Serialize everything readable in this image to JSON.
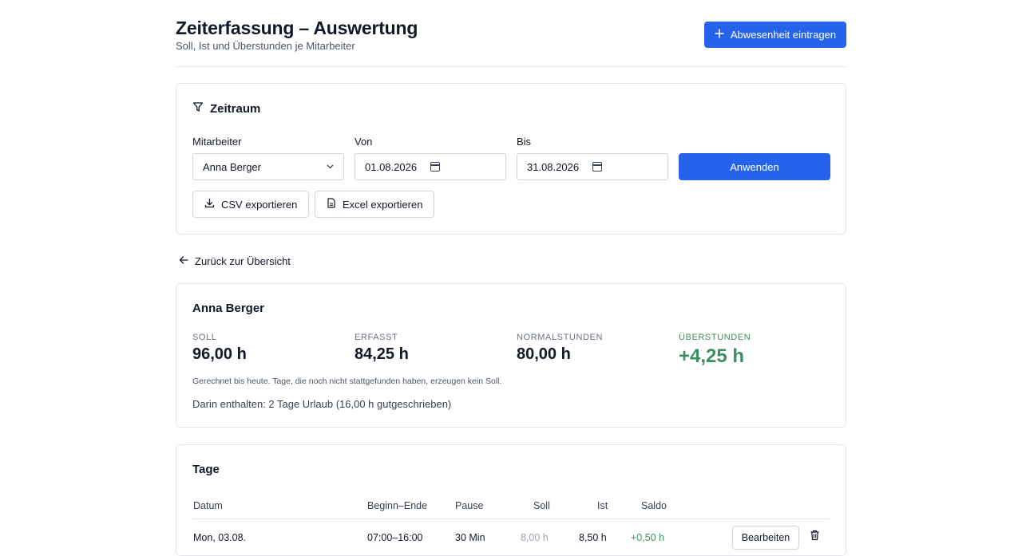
{
  "header": {
    "title": "Zeiterfassung – Auswertung",
    "subtitle": "Soll, Ist und Überstunden je Mitarbeiter",
    "absence_button": "Abwesenheit eintragen"
  },
  "filter": {
    "title": "Zeitraum",
    "employee_label": "Mitarbeiter",
    "employee_value": "Anna Berger",
    "from_label": "Von",
    "from_value": "01.08.2026",
    "to_label": "Bis",
    "to_value": "31.08.2026",
    "apply_button": "Anwenden",
    "csv_button": "CSV exportieren",
    "excel_button": "Excel exportieren"
  },
  "back_link": "Zurück zur Übersicht",
  "summary": {
    "name": "Anna Berger",
    "stats": [
      {
        "label": "SOLL",
        "value": "96,00 h"
      },
      {
        "label": "ERFASST",
        "value": "84,25 h"
      },
      {
        "label": "NORMALSTUNDEN",
        "value": "80,00 h"
      },
      {
        "label": "ÜBERSTUNDEN",
        "value": "+4,25 h"
      }
    ],
    "note_small": "Gerechnet bis heute. Tage, die noch nicht stattgefunden haben, erzeugen kein Soll.",
    "note": "Darin enthalten: 2 Tage Urlaub (16,00 h gutgeschrieben)"
  },
  "days": {
    "title": "Tage",
    "columns": [
      "Datum",
      "Beginn–Ende",
      "Pause",
      "Soll",
      "Ist",
      "Saldo"
    ],
    "rows": [
      {
        "date": "Mon, 03.08.",
        "range": "07:00–16:00",
        "pause": "30 Min",
        "soll": "8,00 h",
        "ist": "8,50 h",
        "saldo": "+0,50 h",
        "edit": "Bearbeiten"
      }
    ]
  },
  "colors": {
    "primary": "#2563eb",
    "positive": "#3e8e63",
    "border": "#e5e7eb"
  }
}
